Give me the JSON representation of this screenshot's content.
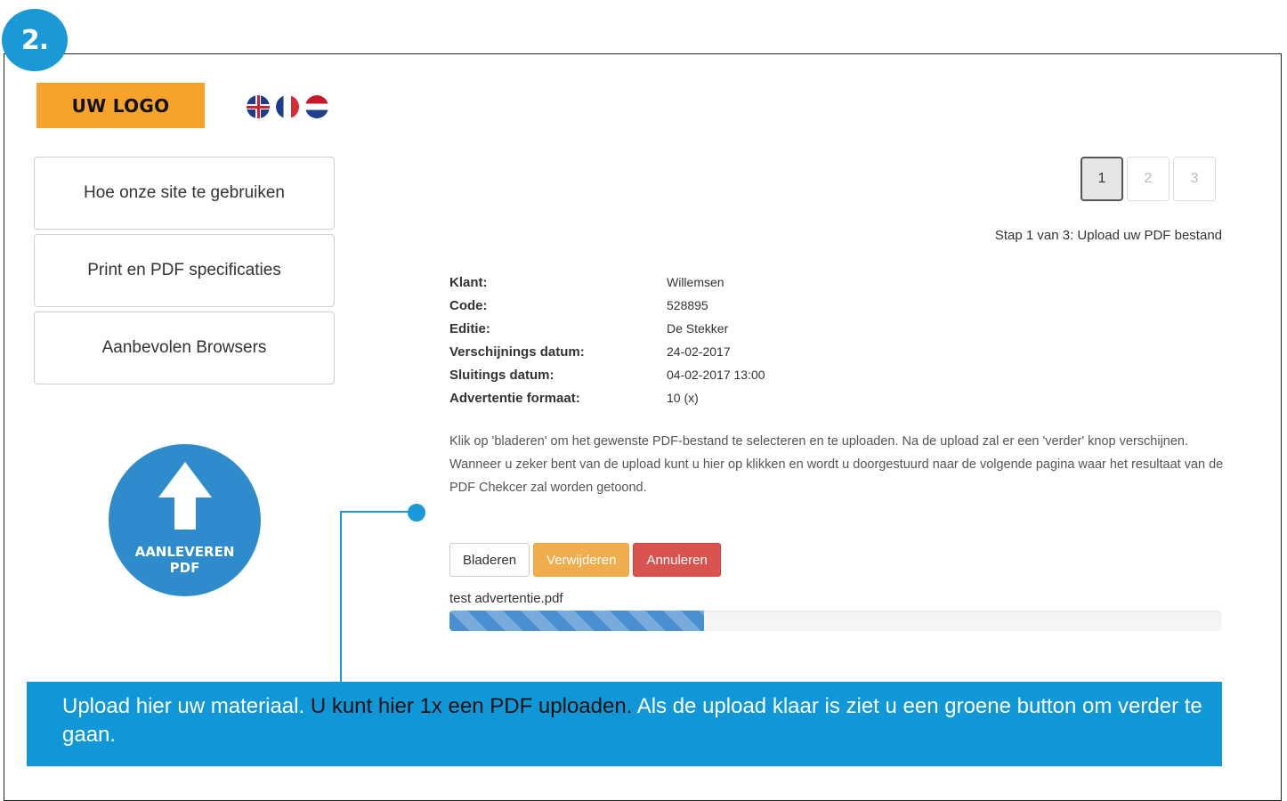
{
  "step_badge": "2.",
  "logo": "UW LOGO",
  "flags": [
    "flag-uk-icon",
    "flag-fr-icon",
    "flag-nl-icon"
  ],
  "sidebar": {
    "items": [
      {
        "label": "Hoe onze site te gebruiken"
      },
      {
        "label": "Print en PDF specificaties"
      },
      {
        "label": "Aanbevolen Browsers"
      }
    ],
    "upload_button": {
      "icon": "arrow-up-icon",
      "label": "AANLEVEREN\nPDF"
    }
  },
  "pagination": {
    "pages": [
      "1",
      "2",
      "3"
    ],
    "active": "1"
  },
  "step_text": "Stap 1 van 3: Upload uw PDF bestand",
  "info": [
    {
      "label": "Klant:",
      "value": "Willemsen"
    },
    {
      "label": "Code:",
      "value": "528895"
    },
    {
      "label": "Editie:",
      "value": "De Stekker"
    },
    {
      "label": "Verschijnings datum:",
      "value": "24-02-2017"
    },
    {
      "label": "Sluitings datum:",
      "value": "04-02-2017 13:00"
    },
    {
      "label": "Advertentie formaat:",
      "value": "10 (x)"
    }
  ],
  "instructions": "Klik op 'bladeren' om het gewenste PDF-bestand te selecteren en te uploaden. Na de upload zal er een 'verder' knop verschijnen. Wanneer u zeker bent van de upload kunt u hier op klikken en wordt u doorgestuurd naar de volgende pagina waar het resultaat van de PDF Chekcer zal worden getoond.",
  "buttons": {
    "browse": "Bladeren",
    "remove": "Verwijderen",
    "cancel": "Annuleren"
  },
  "upload": {
    "filename": "test advertentie.pdf",
    "progress_percent": 33
  },
  "callout": {
    "part1": "Upload hier uw materiaal. ",
    "part2": "U kunt hier 1x een PDF uploaden.",
    "part3": " Als de upload klaar is ziet u een groene button om verder te gaan."
  },
  "colors": {
    "accent": "#1a99d6",
    "logo": "#f7a32b",
    "warning": "#f0ad4e",
    "danger": "#d9534f",
    "progress": "#4a8fd0"
  }
}
